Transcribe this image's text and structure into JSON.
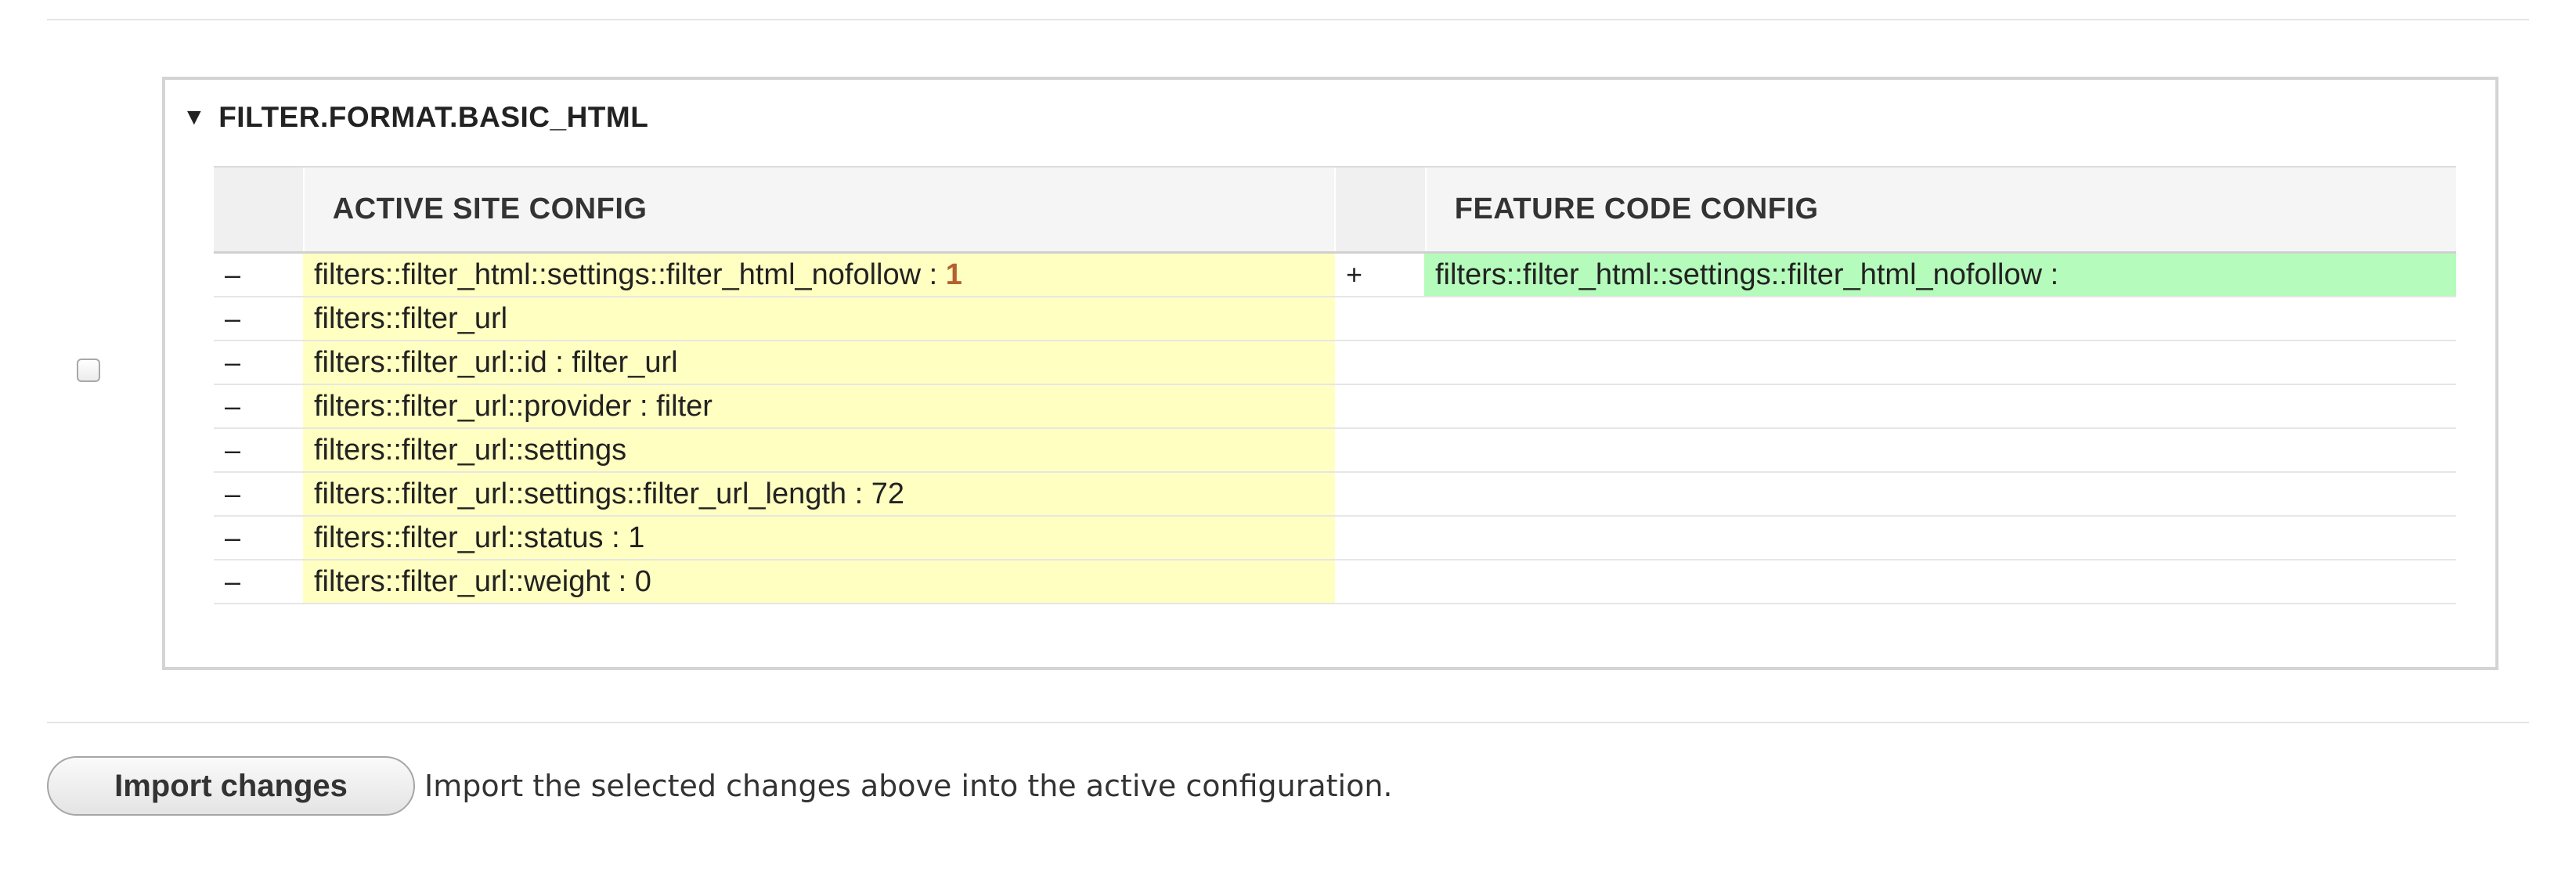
{
  "section": {
    "title": "FILTER.FORMAT.BASIC_HTML",
    "caret": "▼"
  },
  "table": {
    "left_header": "ACTIVE SITE CONFIG",
    "right_header": "FEATURE CODE CONFIG",
    "rows": [
      {
        "left_marker": "–",
        "left_text": "filters::filter_html::settings::filter_html_nofollow : ",
        "left_changed": "1",
        "right_marker": "+",
        "right_text": "filters::filter_html::settings::filter_html_nofollow :"
      },
      {
        "left_marker": "–",
        "left_text": "filters::filter_url",
        "left_changed": "",
        "right_marker": "",
        "right_text": ""
      },
      {
        "left_marker": "–",
        "left_text": "filters::filter_url::id : filter_url",
        "left_changed": "",
        "right_marker": "",
        "right_text": ""
      },
      {
        "left_marker": "–",
        "left_text": "filters::filter_url::provider : filter",
        "left_changed": "",
        "right_marker": "",
        "right_text": ""
      },
      {
        "left_marker": "–",
        "left_text": "filters::filter_url::settings",
        "left_changed": "",
        "right_marker": "",
        "right_text": ""
      },
      {
        "left_marker": "–",
        "left_text": "filters::filter_url::settings::filter_url_length : 72",
        "left_changed": "",
        "right_marker": "",
        "right_text": ""
      },
      {
        "left_marker": "–",
        "left_text": "filters::filter_url::status : 1",
        "left_changed": "",
        "right_marker": "",
        "right_text": ""
      },
      {
        "left_marker": "–",
        "left_text": "filters::filter_url::weight : 0",
        "left_changed": "",
        "right_marker": "",
        "right_text": ""
      }
    ]
  },
  "actions": {
    "import_label": "Import changes",
    "import_description": "Import the selected changes above into the active configuration."
  },
  "colors": {
    "deleted_bg": "#ffffc1",
    "added_bg": "#b5fbbb",
    "changed_text": "#b5602e"
  }
}
